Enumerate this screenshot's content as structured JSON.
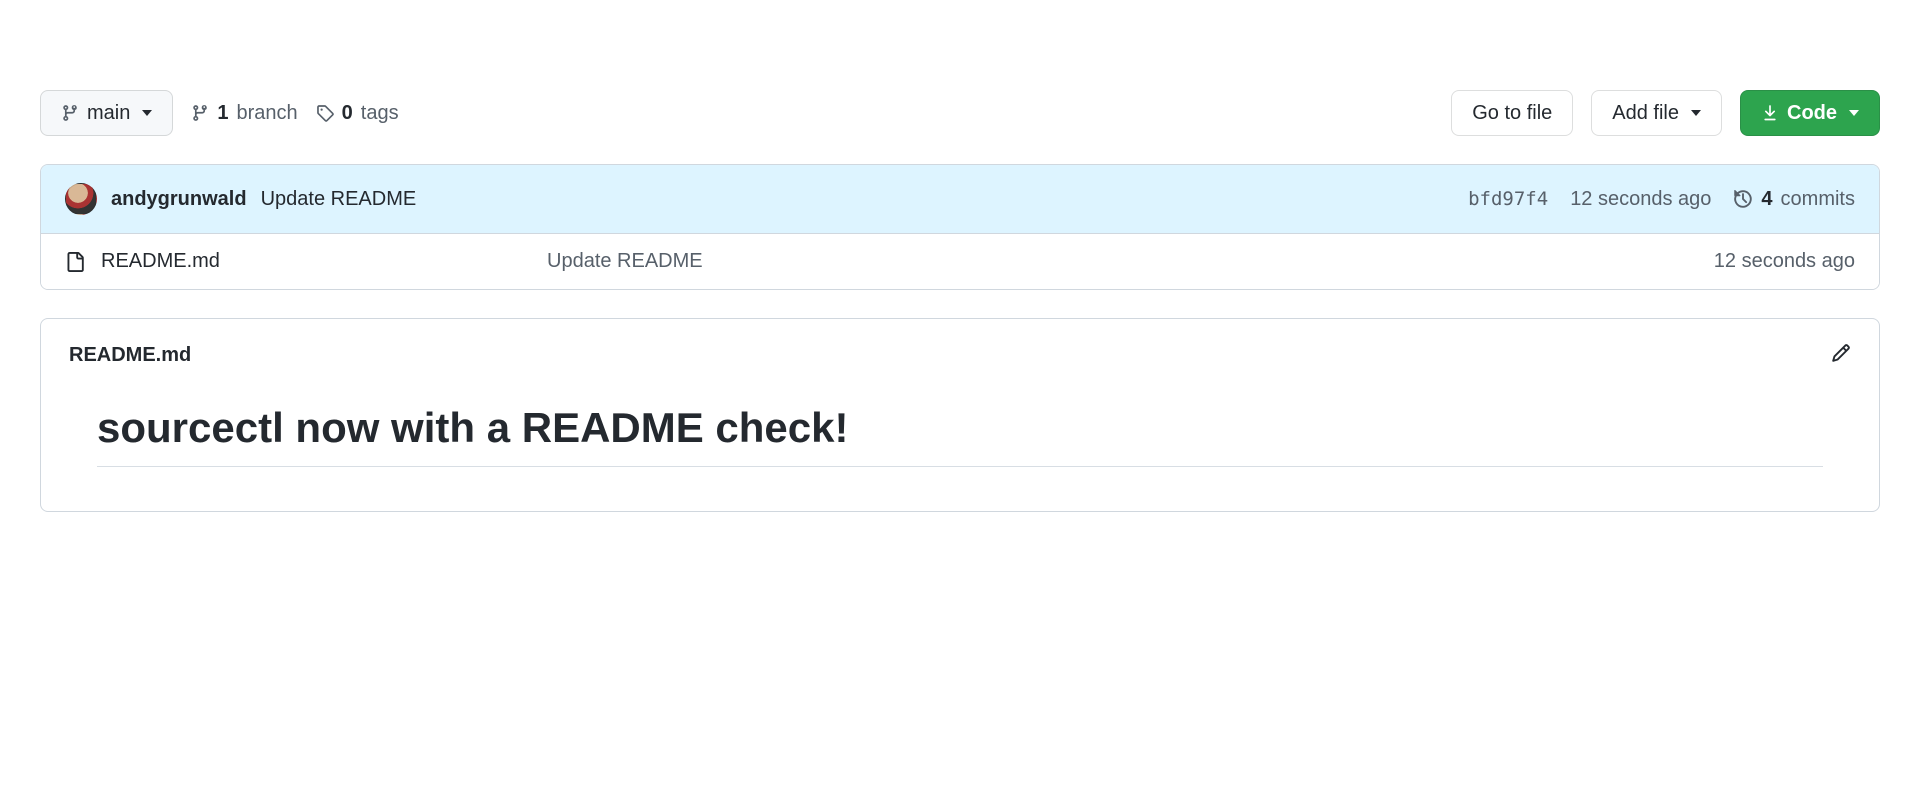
{
  "toolbar": {
    "branch_name": "main",
    "branches": {
      "count": "1",
      "label": "branch"
    },
    "tags": {
      "count": "0",
      "label": "tags"
    },
    "go_to_file": "Go to file",
    "add_file": "Add file",
    "code": "Code"
  },
  "latest_commit": {
    "author": "andygrunwald",
    "message": "Update README",
    "sha": "bfd97f4",
    "relative_time": "12 seconds ago",
    "total_commits": "4",
    "commits_label": "commits"
  },
  "files": [
    {
      "name": "README.md",
      "message": "Update README",
      "time": "12 seconds ago"
    }
  ],
  "readme": {
    "filename": "README.md",
    "heading": "sourcectl now with a README check!"
  }
}
